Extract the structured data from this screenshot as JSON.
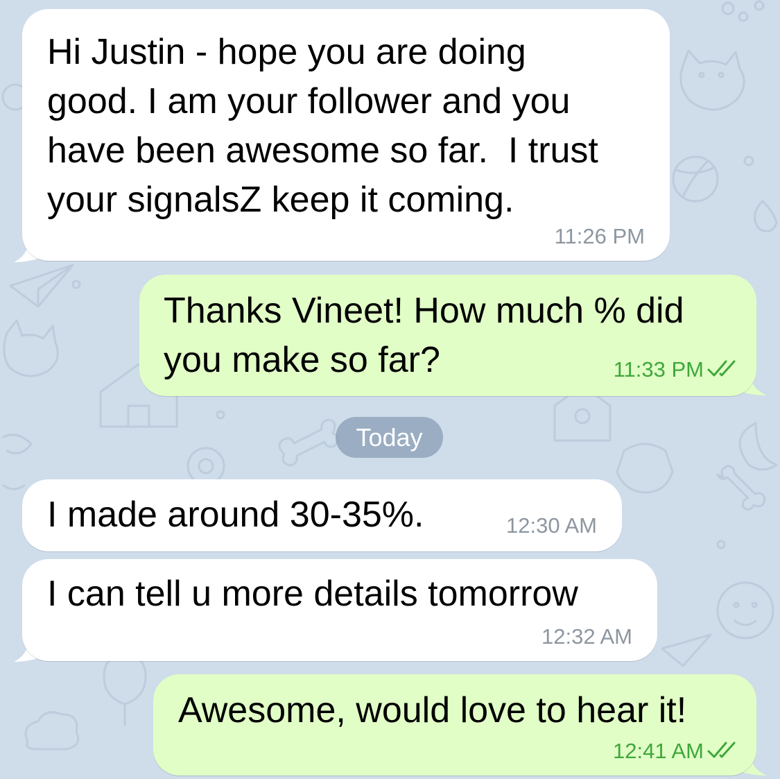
{
  "chat": {
    "messages": [
      {
        "direction": "incoming",
        "text": "Hi Justin - hope you are doing\ngood. I am your follower and you\nhave been awesome so far.  I trust\nyour signalsZ keep it coming.",
        "time": "11:26 PM"
      },
      {
        "direction": "outgoing",
        "text": "Thanks Vineet! How much % did\nyou make so far?",
        "time": "11:33 PM",
        "status": "read"
      },
      {
        "direction": "incoming",
        "text": "I made around 30-35%.",
        "time": "12:30 AM"
      },
      {
        "direction": "incoming",
        "text": "I can tell u more details tomorrow",
        "time": "12:32 AM"
      },
      {
        "direction": "outgoing",
        "text": "Awesome, would love to hear it!",
        "time": "12:41 AM",
        "status": "read"
      }
    ],
    "date_separator": "Today"
  },
  "colors": {
    "background": "#cfdcea",
    "incoming_bubble": "#ffffff",
    "outgoing_bubble": "#e1fec6",
    "outgoing_time": "#3fa73b",
    "incoming_time": "#8d96a0",
    "date_pill": "#8aa0b6"
  },
  "icons": {
    "read_receipt": "double-check-icon",
    "wallpaper": "doodle-pattern"
  }
}
